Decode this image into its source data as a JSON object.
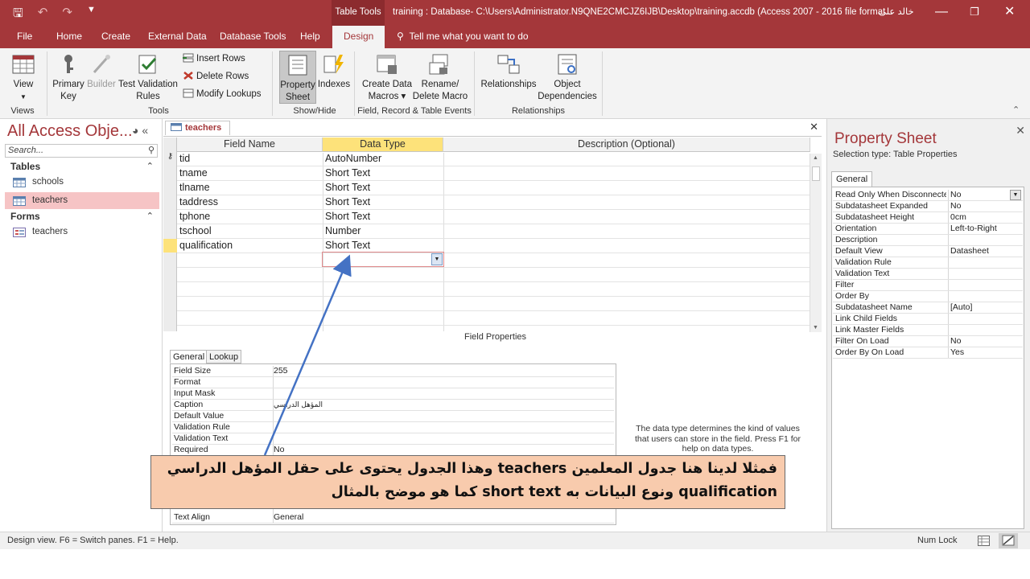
{
  "titlebar": {
    "context_tab": "Table Tools",
    "document": "training : Database- C:\\Users\\Administrator.N9QNE2CMCJZ6IJB\\Desktop\\training.accdb (Access 2007 - 2016 file format...",
    "user": "خالد على",
    "minimize": "—",
    "restore": "❐",
    "close": "✕"
  },
  "ribbon_tabs": [
    "File",
    "Home",
    "Create",
    "External Data",
    "Database Tools",
    "Help",
    "Design"
  ],
  "tell_me": "Tell me what you want to do",
  "ribbon": {
    "view": "View",
    "primary_key": [
      "Primary",
      "Key"
    ],
    "builder": "Builder",
    "test_validation": [
      "Test Validation",
      "Rules"
    ],
    "insert_rows": "Insert Rows",
    "delete_rows": "Delete Rows",
    "modify_lookups": "Modify Lookups",
    "property_sheet": [
      "Property",
      "Sheet"
    ],
    "indexes": "Indexes",
    "create_data_macros": [
      "Create Data",
      "Macros ▾"
    ],
    "rename_delete_macro": [
      "Rename/",
      "Delete Macro"
    ],
    "relationships": "Relationships",
    "object_dependencies": [
      "Object",
      "Dependencies"
    ],
    "groups": [
      "Views",
      "Tools",
      "Show/Hide",
      "Field, Record & Table Events",
      "Relationships"
    ]
  },
  "nav": {
    "title": "All Access Obje...",
    "search_placeholder": "Search...",
    "sections": [
      {
        "label": "Tables",
        "items": [
          "schools",
          "teachers"
        ]
      },
      {
        "label": "Forms",
        "items": [
          "teachers"
        ]
      }
    ]
  },
  "document": {
    "tab": "teachers",
    "columns": [
      "Field Name",
      "Data Type",
      "Description (Optional)"
    ],
    "rows": [
      {
        "field": "tid",
        "type": "AutoNumber"
      },
      {
        "field": "tname",
        "type": "Short Text"
      },
      {
        "field": "tlname",
        "type": "Short Text"
      },
      {
        "field": "taddress",
        "type": "Short Text"
      },
      {
        "field": "tphone",
        "type": "Short Text"
      },
      {
        "field": "tschool",
        "type": "Number"
      },
      {
        "field": "qualification",
        "type": "Short Text"
      }
    ],
    "field_properties_title": "Field Properties",
    "fp_tabs": [
      "General",
      "Lookup"
    ],
    "field_properties": [
      {
        "k": "Field Size",
        "v": "255"
      },
      {
        "k": "Format",
        "v": ""
      },
      {
        "k": "Input Mask",
        "v": ""
      },
      {
        "k": "Caption",
        "v": "المؤهل الدراسي"
      },
      {
        "k": "Default Value",
        "v": ""
      },
      {
        "k": "Validation Rule",
        "v": ""
      },
      {
        "k": "Validation Text",
        "v": ""
      },
      {
        "k": "Required",
        "v": "No"
      },
      {
        "k": "Text Align",
        "v": "General"
      }
    ],
    "help_text": [
      "The data type determines the kind of values",
      "that users can store in the field. Press F1 for",
      "help on data types."
    ]
  },
  "property_sheet": {
    "title": "Property Sheet",
    "selection_type": "Selection type:  Table Properties",
    "tab": "General",
    "rows": [
      {
        "k": "Read Only When Disconnected",
        "v": "No"
      },
      {
        "k": "Subdatasheet Expanded",
        "v": "No"
      },
      {
        "k": "Subdatasheet Height",
        "v": "0cm"
      },
      {
        "k": "Orientation",
        "v": "Left-to-Right"
      },
      {
        "k": "Description",
        "v": ""
      },
      {
        "k": "Default View",
        "v": "Datasheet"
      },
      {
        "k": "Validation Rule",
        "v": ""
      },
      {
        "k": "Validation Text",
        "v": ""
      },
      {
        "k": "Filter",
        "v": ""
      },
      {
        "k": "Order By",
        "v": ""
      },
      {
        "k": "Subdatasheet Name",
        "v": "[Auto]"
      },
      {
        "k": "Link Child Fields",
        "v": ""
      },
      {
        "k": "Link Master Fields",
        "v": ""
      },
      {
        "k": "Filter On Load",
        "v": "No"
      },
      {
        "k": "Order By On Load",
        "v": "Yes"
      }
    ]
  },
  "status": {
    "left": "Design view.  F6 = Switch panes.  F1 = Help.",
    "right": "Num Lock"
  },
  "annotation": {
    "line1": "فمثلا لدينا هنا جدول المعلمين teachers وهذا الجدول يحتوى على حقل المؤهل الدراسي",
    "line2": "qualification ونوع البيانات به short text كما هو موضح بالمثال"
  },
  "colors": {
    "accent": "#a4373a",
    "callout_fill": "#f8cbad",
    "arrow": "#4472c4",
    "header_highlight": "#fde27a"
  }
}
